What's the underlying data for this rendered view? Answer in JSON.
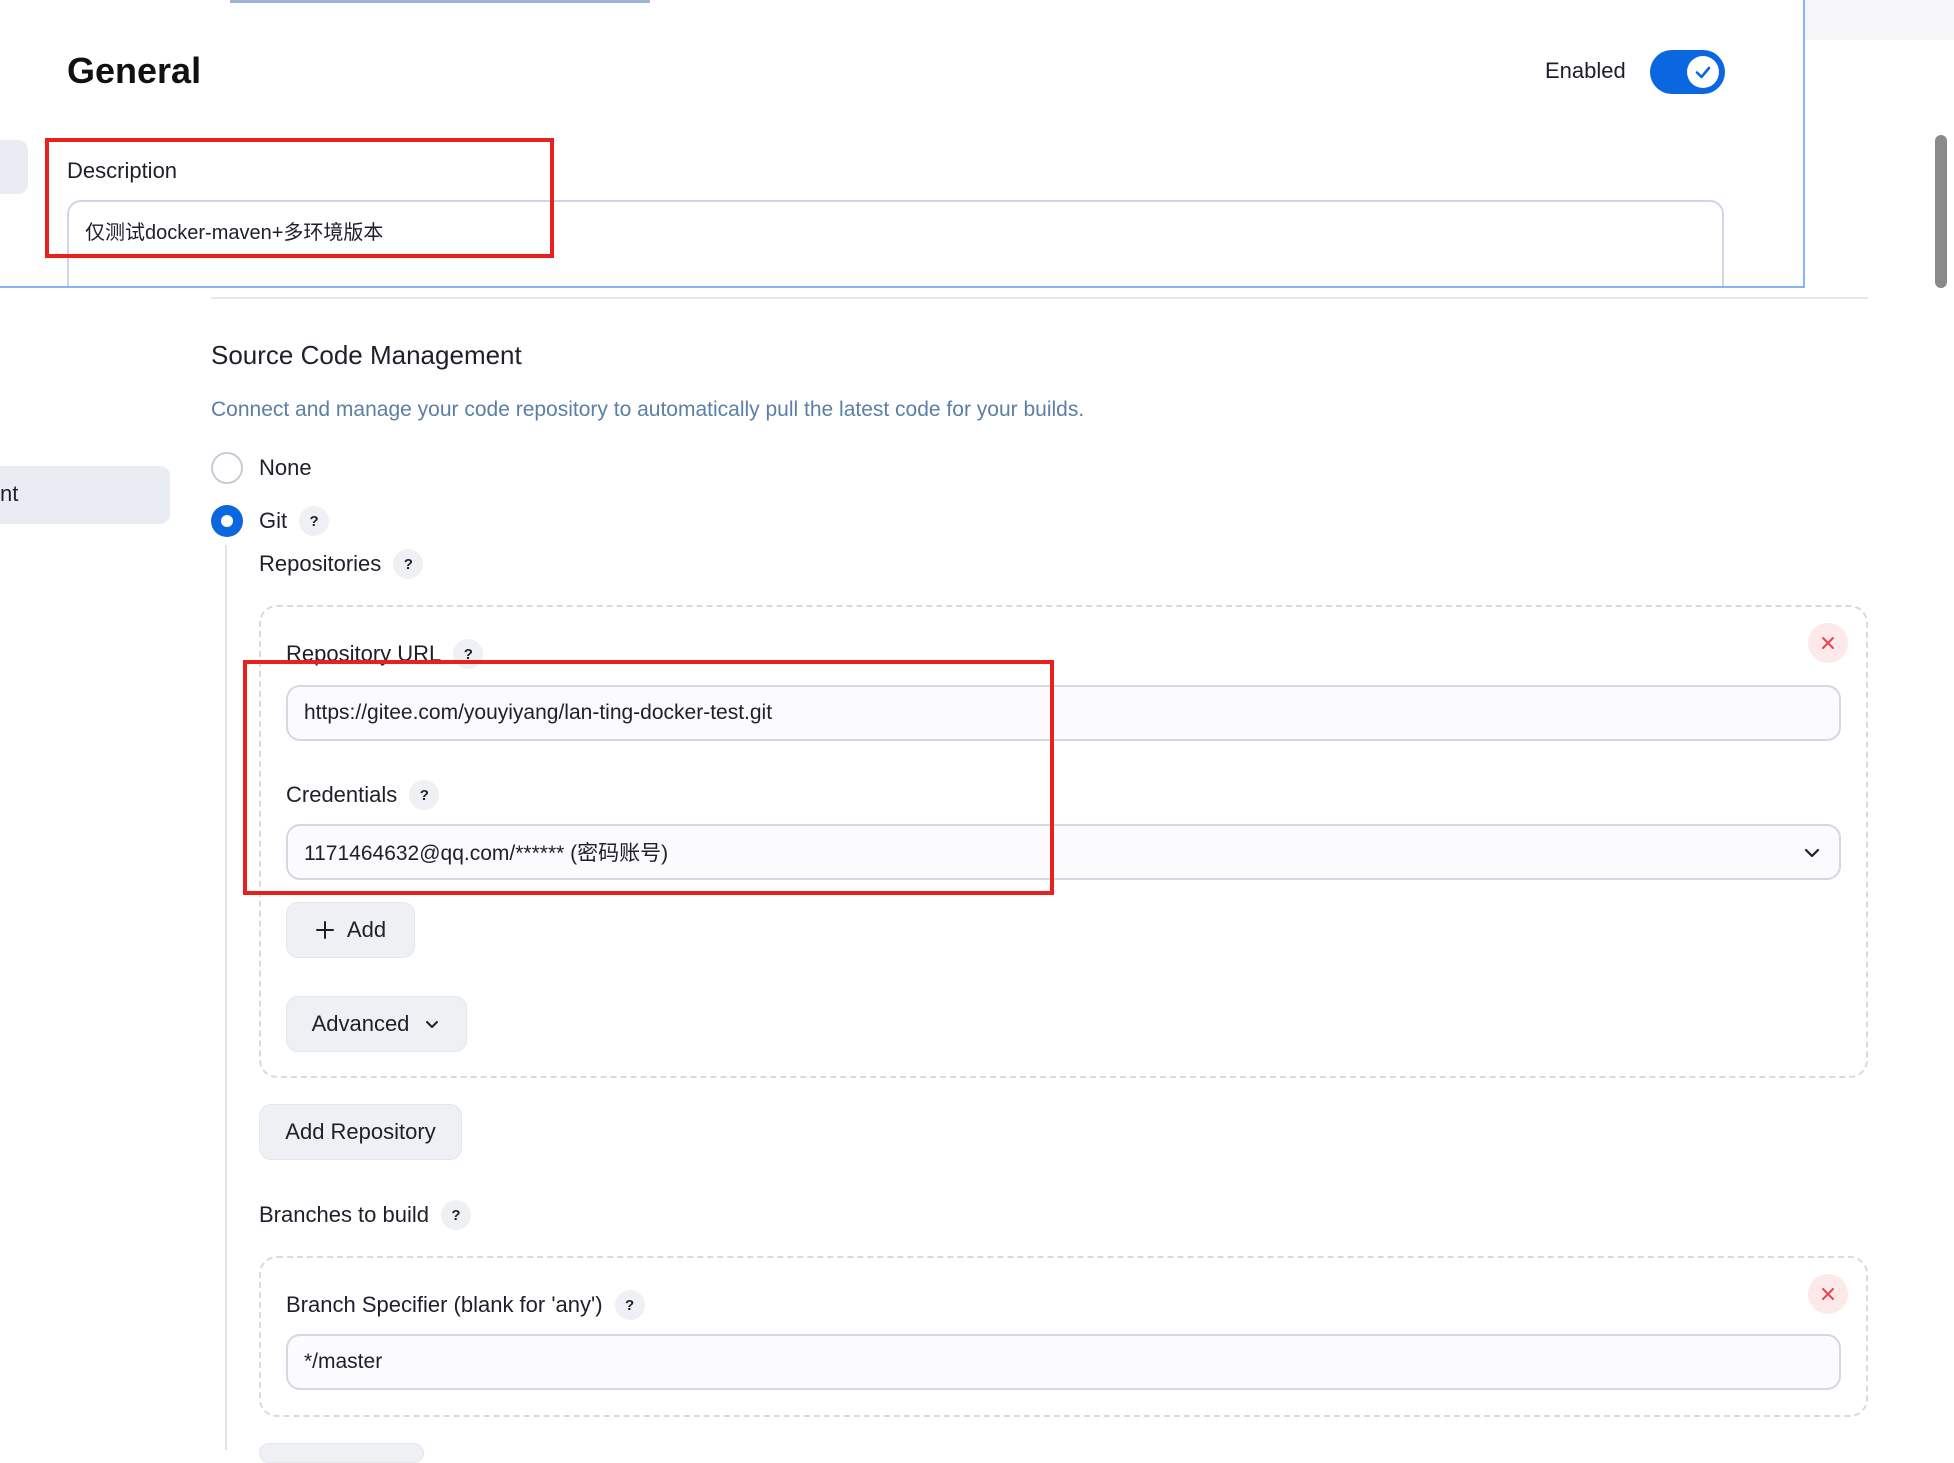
{
  "general": {
    "title": "General",
    "enabled_label": "Enabled",
    "enabled": true,
    "description_label": "Description",
    "description_value": "仅测试docker-maven+多环境版本"
  },
  "nav": {
    "partial_item_label": "nt"
  },
  "scm": {
    "title": "Source Code Management",
    "description": "Connect and manage your code repository to automatically pull the latest code for your builds.",
    "options": [
      {
        "label": "None",
        "checked": false
      },
      {
        "label": "Git",
        "checked": true
      }
    ],
    "repositories_label": "Repositories",
    "repository": {
      "url_label": "Repository URL",
      "url_value": "https://gitee.com/youyiyang/lan-ting-docker-test.git",
      "credentials_label": "Credentials",
      "credentials_value": "1171464632@qq.com/****** (密码账号)",
      "add_label": "Add",
      "advanced_label": "Advanced"
    },
    "add_repository_label": "Add Repository",
    "branches_label": "Branches to build",
    "branch": {
      "specifier_label": "Branch Specifier (blank for 'any')",
      "specifier_value": "*/master"
    },
    "help_glyph": "?"
  },
  "colors": {
    "accent": "#0b67e0",
    "annotation": "#e8211e",
    "description_text": "#5b7fa6",
    "close_bg": "#fde8ea",
    "close_fg": "#e5484d"
  }
}
